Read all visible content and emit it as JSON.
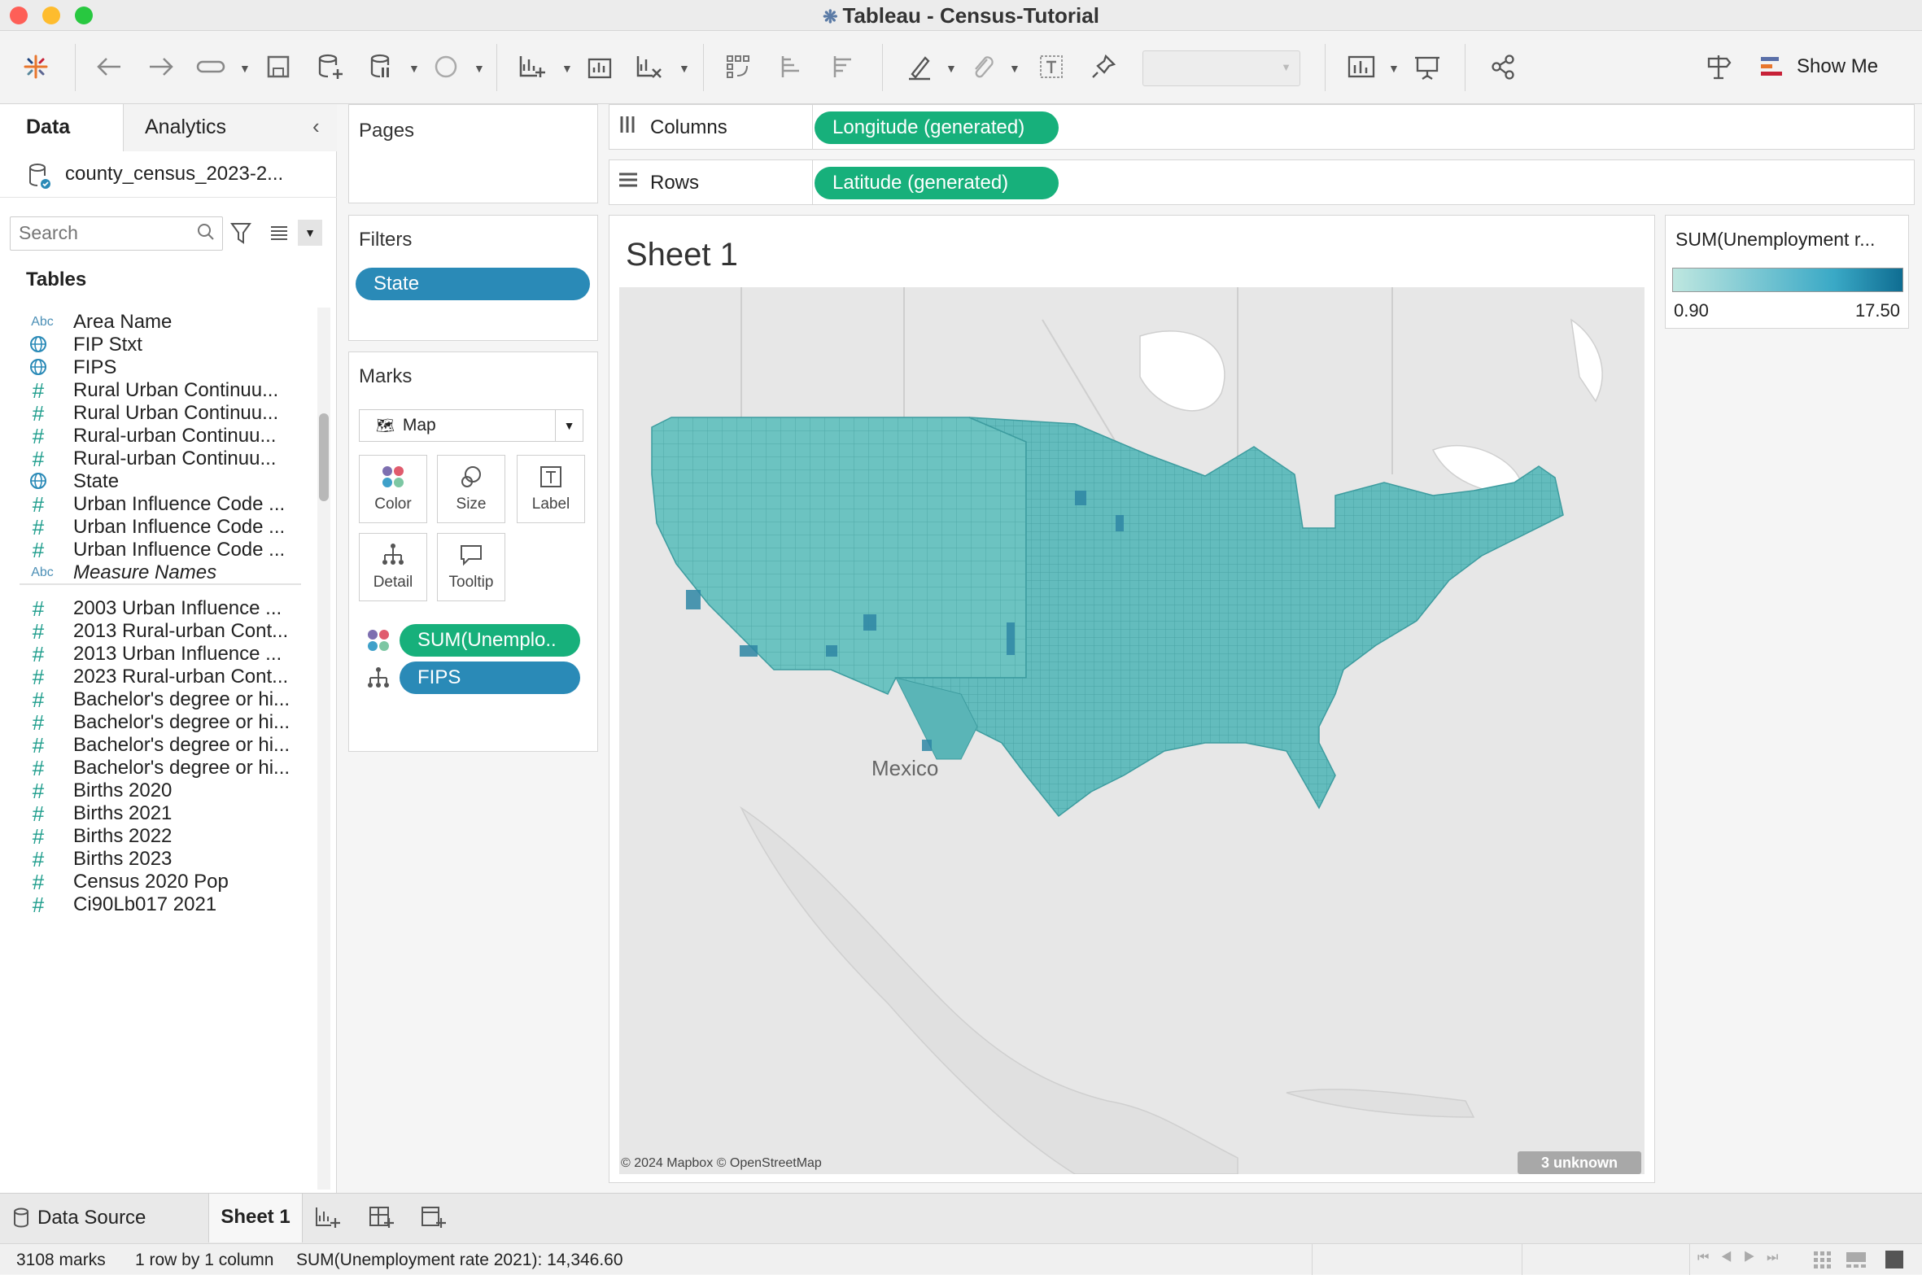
{
  "window": {
    "title": "Tableau - Census-Tutorial"
  },
  "toolbar": {
    "show_me_label": "Show Me"
  },
  "data_pane": {
    "tab_data": "Data",
    "tab_analytics": "Analytics",
    "datasource": "county_census_2023-2...",
    "search_placeholder": "Search",
    "tables_heading": "Tables",
    "fields": [
      {
        "icon": "Abc",
        "label": "Area Name",
        "italic": false
      },
      {
        "icon": "globe",
        "label": "FIP Stxt",
        "italic": false
      },
      {
        "icon": "globe-link",
        "label": "FIPS",
        "italic": false
      },
      {
        "icon": "#",
        "label": "Rural Urban Continuu...",
        "italic": false
      },
      {
        "icon": "#",
        "label": "Rural Urban Continuu...",
        "italic": false
      },
      {
        "icon": "#",
        "label": "Rural-urban Continuu...",
        "italic": false
      },
      {
        "icon": "#",
        "label": "Rural-urban Continuu...",
        "italic": false
      },
      {
        "icon": "globe",
        "label": "State",
        "italic": false
      },
      {
        "icon": "#",
        "label": "Urban Influence Code ...",
        "italic": false
      },
      {
        "icon": "#",
        "label": "Urban Influence Code ...",
        "italic": false
      },
      {
        "icon": "#",
        "label": "Urban Influence Code ...",
        "italic": false
      },
      {
        "icon": "Abc",
        "label": "Measure Names",
        "italic": true
      }
    ],
    "measures": [
      "2003 Urban Influence ...",
      "2013 Rural-urban Cont...",
      "2013 Urban Influence ...",
      "2023 Rural-urban Cont...",
      "Bachelor's degree or hi...",
      "Bachelor's degree or hi...",
      "Bachelor's degree or hi...",
      "Bachelor's degree or hi...",
      "Births 2020",
      "Births 2021",
      "Births 2022",
      "Births 2023",
      "Census 2020 Pop",
      "Ci90Lb017 2021"
    ]
  },
  "pages": {
    "title": "Pages"
  },
  "filters": {
    "title": "Filters",
    "items": [
      "State"
    ]
  },
  "marks": {
    "title": "Marks",
    "type": "Map",
    "buttons": [
      "Color",
      "Size",
      "Label",
      "Detail",
      "Tooltip"
    ],
    "pills": [
      "SUM(Unemplo..",
      "FIPS"
    ]
  },
  "shelves": {
    "columns_label": "Columns",
    "columns_pill": "Longitude (generated)",
    "rows_label": "Rows",
    "rows_pill": "Latitude (generated)"
  },
  "sheet": {
    "title": "Sheet 1",
    "map_label": "Mexico",
    "attribution": "© 2024 Mapbox © OpenStreetMap",
    "unknown_badge": "3 unknown"
  },
  "legend": {
    "title": "SUM(Unemployment r...",
    "min": "0.90",
    "max": "17.50",
    "color_low": "#bfe7e0",
    "color_high": "#0f6d92"
  },
  "sheet_tabs": {
    "data_source": "Data Source",
    "sheet1": "Sheet 1"
  },
  "status": {
    "marks": "3108 marks",
    "dims": "1 row by 1 column",
    "sum": "SUM(Unemployment rate 2021): 14,346.60"
  },
  "colors": {
    "pill_green": "#17b07b",
    "pill_blue": "#2a8ab7",
    "map_fill": "#6cc3c1"
  }
}
